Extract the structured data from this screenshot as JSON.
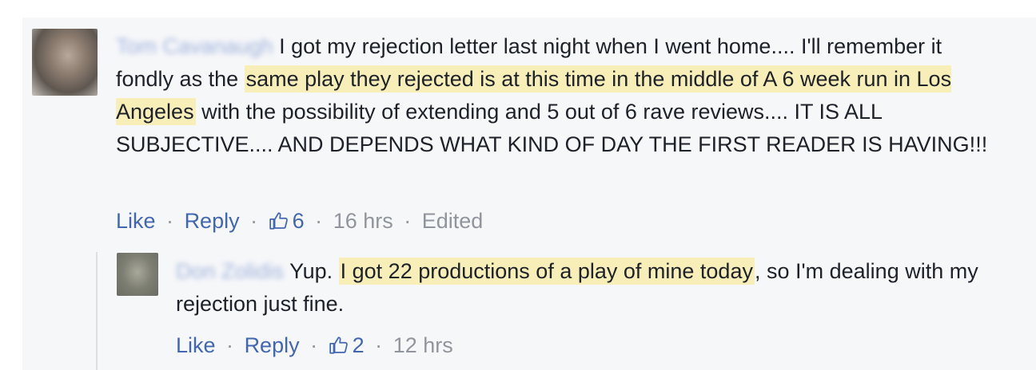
{
  "main_comment": {
    "author": "Tom Cavanaugh",
    "text_before": "I got my rejection letter last night when I went home.... I'll remember it fondly as the ",
    "highlight": "same play they rejected is at this time in the middle of A 6 week run in Los Angeles",
    "text_after": " with the possibility of extending and 5 out of 6 rave reviews.... IT IS ALL SUBJECTIVE.... AND DEPENDS WHAT KIND OF DAY THE FIRST READER IS HAVING!!!",
    "like_label": "Like",
    "reply_label": "Reply",
    "like_count": "6",
    "time": "16 hrs",
    "edited": "Edited"
  },
  "reply_comment": {
    "author": "Don Zolidis",
    "text_before": "Yup. ",
    "highlight": "I got 22 productions of a play of mine today",
    "text_after": ", so I'm dealing with my rejection just fine.",
    "like_label": "Like",
    "reply_label": "Reply",
    "like_count": "2",
    "time": "12 hrs"
  },
  "separator": "·",
  "colors": {
    "link": "#4267b2",
    "text": "#1d2129",
    "meta": "#90949c",
    "highlight": "#f7eeb8",
    "panel": "#f6f7f9"
  },
  "icons": {
    "like": "thumbs-up-icon"
  }
}
